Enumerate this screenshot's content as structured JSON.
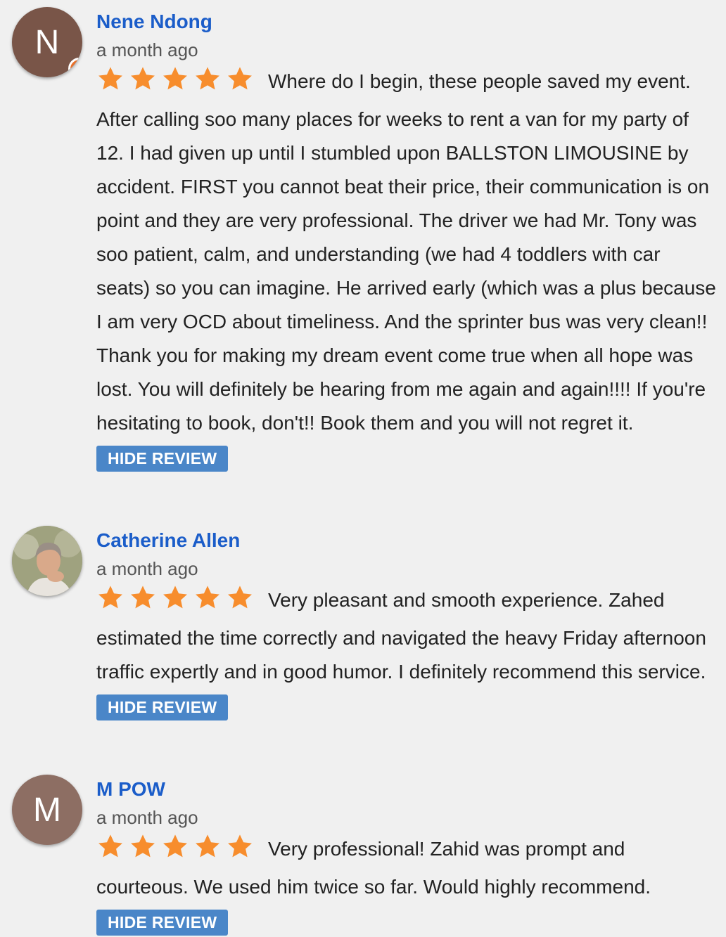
{
  "reviews": [
    {
      "author": "Nene Ndong",
      "avatar_letter": "N",
      "avatar_color": "#795548",
      "date": "a month ago",
      "rating": 5,
      "text": "Where do I begin,  these people saved my event. After calling soo many places for weeks to rent a van for my party of 12. I had given up until I stumbled upon BALLSTON LIMOUSINE by accident.  FIRST you cannot beat their price, their communication is on point and they are very professional.  The driver we had Mr. Tony was soo patient, calm, and understanding (we had 4 toddlers with car seats) so you can imagine. He arrived early (which was a plus because I am very OCD about timeliness. And the sprinter bus was very clean!! Thank you for making my dream event come true when all hope was lost.  You will definitely be hearing from me again and again!!!! If you're hesitating to book, don't!! Book them and you will not regret it.",
      "hide_label": "HIDE REVIEW"
    },
    {
      "author": "Catherine Allen",
      "date": "a month ago",
      "rating": 5,
      "text": "Very pleasant and smooth experience.  Zahed estimated the time correctly and navigated the heavy Friday afternoon traffic expertly and in good humor. I definitely recommend this service.",
      "hide_label": "HIDE REVIEW"
    },
    {
      "author": "M POW",
      "avatar_letter": "M",
      "avatar_color": "#8d6e63",
      "date": "a month ago",
      "rating": 5,
      "text": "Very professional!  Zahid was prompt and courteous.  We used him twice so far.   Would highly recommend.",
      "hide_label": "HIDE REVIEW"
    }
  ],
  "colors": {
    "author": "#1b5dc9",
    "star": "#f78d2d",
    "button": "#4a86c8",
    "badge": "#e8712b"
  }
}
